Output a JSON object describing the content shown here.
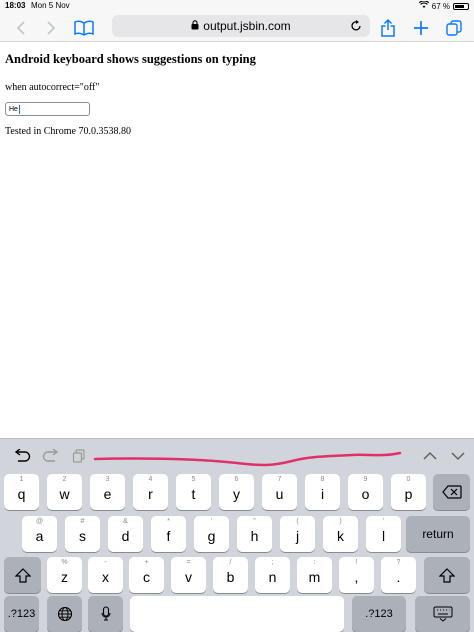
{
  "status_bar": {
    "time": "18:03",
    "date": "Mon 5 Nov",
    "battery": "67 %"
  },
  "browser": {
    "url": "output.jsbin.com"
  },
  "page": {
    "heading": "Android keyboard shows suggestions on typing",
    "subtitle": "when autocorrect=\"off\"",
    "input_value": "He",
    "tested": "Tested in Chrome 70.0.3538.80"
  },
  "keyboard": {
    "row1": [
      {
        "alt": "1",
        "main": "q"
      },
      {
        "alt": "2",
        "main": "w"
      },
      {
        "alt": "3",
        "main": "e"
      },
      {
        "alt": "4",
        "main": "r"
      },
      {
        "alt": "5",
        "main": "t"
      },
      {
        "alt": "6",
        "main": "y"
      },
      {
        "alt": "7",
        "main": "u"
      },
      {
        "alt": "8",
        "main": "i"
      },
      {
        "alt": "9",
        "main": "o"
      },
      {
        "alt": "0",
        "main": "p"
      }
    ],
    "row2": [
      {
        "alt": "@",
        "main": "a"
      },
      {
        "alt": "#",
        "main": "s"
      },
      {
        "alt": "&",
        "main": "d"
      },
      {
        "alt": "*",
        "main": "f"
      },
      {
        "alt": "'",
        "main": "g"
      },
      {
        "alt": "\"",
        "main": "h"
      },
      {
        "alt": "(",
        "main": "j"
      },
      {
        "alt": ")",
        "main": "k"
      },
      {
        "alt": "'",
        "main": "l"
      }
    ],
    "row3": [
      {
        "alt": "%",
        "main": "z"
      },
      {
        "alt": "-",
        "main": "x"
      },
      {
        "alt": "+",
        "main": "c"
      },
      {
        "alt": "=",
        "main": "v"
      },
      {
        "alt": "/",
        "main": "b"
      },
      {
        "alt": ";",
        "main": "n"
      },
      {
        "alt": ":",
        "main": "m"
      },
      {
        "alt": "!",
        "main": ","
      },
      {
        "alt": "?",
        "main": "."
      }
    ],
    "return_label": "return",
    "numbers_label": ".?123"
  }
}
